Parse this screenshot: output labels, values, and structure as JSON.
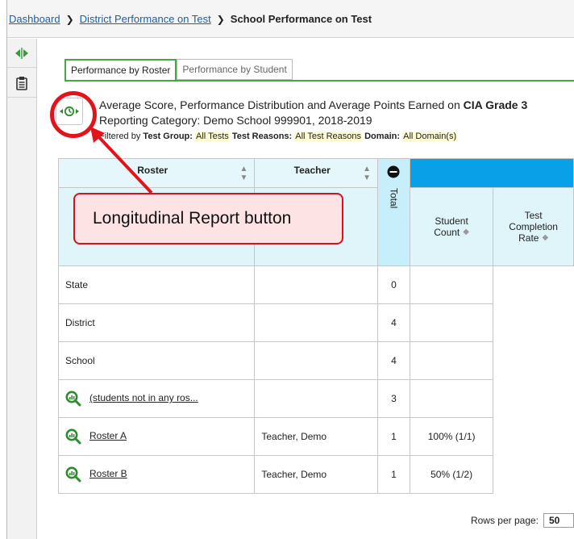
{
  "breadcrumb": {
    "items": [
      "Dashboard",
      "District Performance on Test"
    ],
    "current": "School Performance on Test"
  },
  "tabs": [
    "Performance by Roster",
    "Performance by Student"
  ],
  "report": {
    "title_prefix": "Average Score, Performance Distribution and Average Points Earned on ",
    "title_bold": "CIA Grade 3",
    "subtitle": "Reporting Category: Demo School 999901, 2018-2019",
    "filters": {
      "lead": "Filtered by ",
      "test_group_label": "Test Group:",
      "test_group_value": "All Tests",
      "test_reasons_label": "Test Reasons:",
      "test_reasons_value": "All Test Reasons",
      "domain_label": "Domain:",
      "domain_value": "All Domain(s)"
    }
  },
  "callout": {
    "text": "Longitudinal Report button"
  },
  "table": {
    "headers": {
      "roster": "Roster",
      "teacher": "Teacher",
      "total": "Total",
      "student_count": "Student Count",
      "completion_rate": "Test Completion Rate"
    },
    "rows": [
      {
        "roster": "State",
        "teacher": "",
        "count": "0",
        "rate": "",
        "link": false
      },
      {
        "roster": "District",
        "teacher": "",
        "count": "4",
        "rate": "",
        "link": false
      },
      {
        "roster": "School",
        "teacher": "",
        "count": "4",
        "rate": "",
        "link": false
      },
      {
        "roster": "(students not in any ros...",
        "teacher": "",
        "count": "3",
        "rate": "",
        "link": true
      },
      {
        "roster": "Roster A",
        "teacher": "Teacher, Demo",
        "count": "1",
        "rate": "100% (1/1)",
        "link": true
      },
      {
        "roster": "Roster B",
        "teacher": "Teacher, Demo",
        "count": "1",
        "rate": "50% (1/2)",
        "link": true
      }
    ]
  },
  "pagination": {
    "rows_per_page_label": "Rows per page:",
    "rows_per_page_value": "50"
  },
  "colors": {
    "accent_green": "#4aa54a",
    "header_blue": "#0aa0e8",
    "callout_red": "#d3141c"
  }
}
